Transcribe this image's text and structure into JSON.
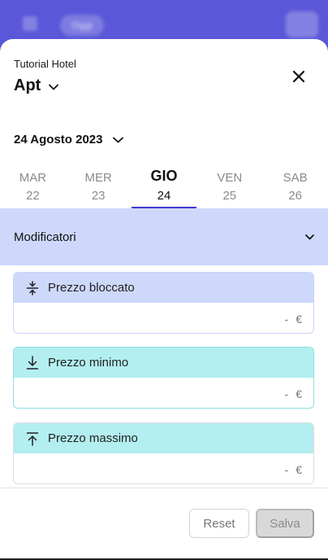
{
  "background": {
    "pill_label": "Oggi"
  },
  "sheet": {
    "hotel_name": "Tutorial Hotel",
    "room_type": "Apt",
    "date": "24 Agosto 2023",
    "days": [
      {
        "name": "MAR",
        "num": "22",
        "active": false
      },
      {
        "name": "MER",
        "num": "23",
        "active": false
      },
      {
        "name": "GIO",
        "num": "24",
        "active": true
      },
      {
        "name": "VEN",
        "num": "25",
        "active": false
      },
      {
        "name": "SAB",
        "num": "26",
        "active": false
      }
    ],
    "modifiers_label": "Modificatori",
    "cards": [
      {
        "title": "Prezzo bloccato",
        "value": "-",
        "currency": "€",
        "icon": "lock-price-icon"
      },
      {
        "title": "Prezzo minimo",
        "value": "-",
        "currency": "€",
        "icon": "arrow-down-to-line-icon"
      },
      {
        "title": "Prezzo massimo",
        "value": "-",
        "currency": "€",
        "icon": "arrow-up-to-line-icon"
      }
    ],
    "reset_label": "Reset",
    "save_label": "Salva"
  },
  "colors": {
    "accent": "#3b3bcf",
    "header_bg": "#5a58d8",
    "modifiers_bg": "#cdd8fb",
    "min_max_bg": "#b3eef0"
  }
}
